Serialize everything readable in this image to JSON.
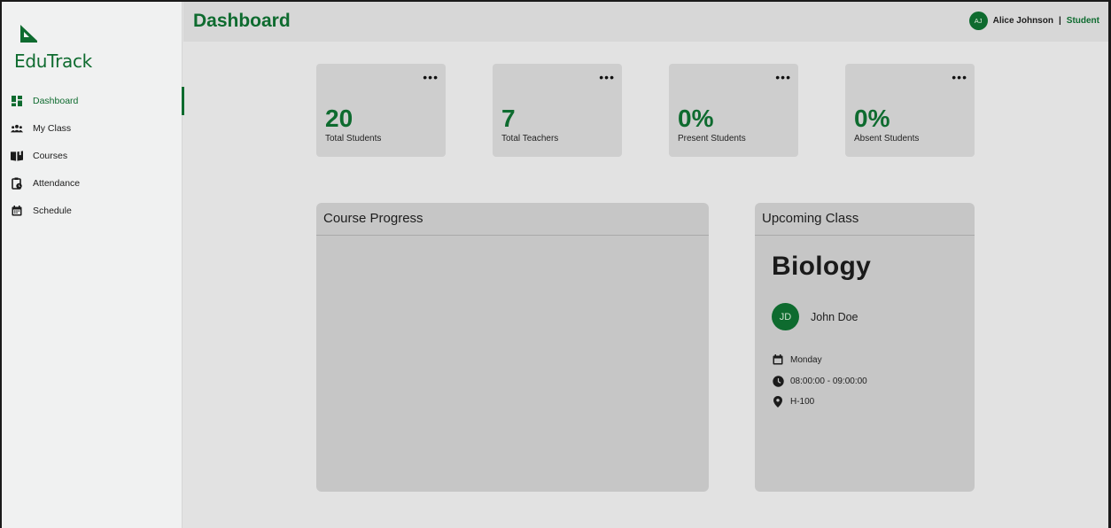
{
  "brand": {
    "name": "EduTrack",
    "color": "#0e6b2f"
  },
  "sidebar": {
    "items": [
      {
        "label": "Dashboard",
        "icon": "dashboard-icon",
        "active": true
      },
      {
        "label": "My Class",
        "icon": "group-icon",
        "active": false
      },
      {
        "label": "Courses",
        "icon": "book-icon",
        "active": false
      },
      {
        "label": "Attendance",
        "icon": "clipboard-clock-icon",
        "active": false
      },
      {
        "label": "Schedule",
        "icon": "calendar-icon",
        "active": false
      }
    ]
  },
  "header": {
    "title": "Dashboard",
    "user": {
      "initials": "AJ",
      "name": "Alice Johnson",
      "separator": "|",
      "role": "Student"
    }
  },
  "stats": [
    {
      "value": "20",
      "label": "Total Students",
      "menu": "•••"
    },
    {
      "value": "7",
      "label": "Total Teachers",
      "menu": "•••"
    },
    {
      "value": "0%",
      "label": "Present Students",
      "menu": "•••"
    },
    {
      "value": "0%",
      "label": "Absent Students",
      "menu": "•••"
    }
  ],
  "course_progress": {
    "title": "Course Progress"
  },
  "upcoming_class": {
    "title": "Upcoming Class",
    "subject": "Biology",
    "teacher": {
      "initials": "JD",
      "name": "John Doe"
    },
    "day": "Monday",
    "time": "08:00:00 - 09:00:00",
    "room": "H-100"
  }
}
